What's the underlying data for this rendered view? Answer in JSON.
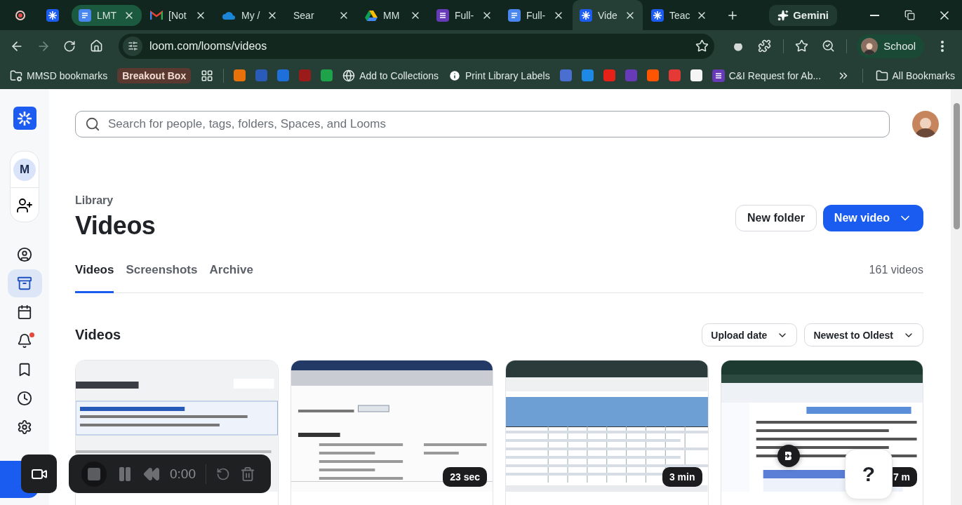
{
  "browser": {
    "tabs": [
      {
        "selected": false,
        "hovered": false
      },
      {
        "title": "LMT",
        "selected": false,
        "hovered": true
      },
      {
        "title": "[Not",
        "selected": false,
        "hovered": false
      },
      {
        "title": "My /",
        "selected": false,
        "hovered": false
      },
      {
        "title": "Sear",
        "selected": false,
        "hovered": false
      },
      {
        "title": "MM",
        "selected": false,
        "hovered": false
      },
      {
        "title": "Full-",
        "selected": false,
        "hovered": false
      },
      {
        "title": "Full-",
        "selected": false,
        "hovered": false
      },
      {
        "title": "Vide",
        "selected": true,
        "hovered": false
      },
      {
        "title": "Teac",
        "selected": false,
        "hovered": false
      }
    ],
    "gemini": "Gemini",
    "url": "loom.com/looms/videos",
    "profile": "School",
    "bookmarks": [
      {
        "kind": "folder",
        "label": "MMSD bookmarks"
      },
      {
        "kind": "chip",
        "label": "Breakout Box"
      },
      {
        "kind": "apps"
      },
      {
        "kind": "separator"
      },
      {
        "kind": "icon",
        "color": "#e8710a"
      },
      {
        "kind": "icon",
        "color": "#2a5bb8"
      },
      {
        "kind": "icon",
        "color": "#1e6fd9"
      },
      {
        "kind": "icon",
        "color": "#9b1b1b"
      },
      {
        "kind": "icon",
        "color": "#1fa34a"
      },
      {
        "kind": "link",
        "label": "Add to Collections"
      },
      {
        "kind": "link",
        "label": "Print Library Labels"
      },
      {
        "kind": "icon",
        "color": "#4a6fd1"
      },
      {
        "kind": "icon",
        "color": "#1e88e5"
      },
      {
        "kind": "icon",
        "color": "#e62117"
      },
      {
        "kind": "icon",
        "color": "#673ab7"
      },
      {
        "kind": "icon",
        "color": "#ff5500"
      },
      {
        "kind": "icon",
        "color": "#e53935"
      },
      {
        "kind": "icon",
        "color": "#f5f5f5"
      },
      {
        "kind": "link",
        "label": "C&I Request for Ab..."
      }
    ],
    "all_bookmarks": "All Bookmarks"
  },
  "sidebar": {
    "workspace_initial": "M",
    "nav": [
      {
        "selected": false,
        "unread": false
      },
      {
        "selected": true,
        "unread": false
      },
      {
        "selected": false,
        "unread": false
      },
      {
        "selected": false,
        "unread": true
      },
      {
        "selected": false,
        "unread": false
      },
      {
        "selected": false,
        "unread": false
      },
      {
        "selected": false,
        "unread": false
      }
    ]
  },
  "search": {
    "placeholder": "Search for people, tags, folders, Spaces, and Looms"
  },
  "header": {
    "eyebrow": "Library",
    "title": "Videos",
    "buttons": [
      {
        "kind": "secondary",
        "label": "New folder"
      },
      {
        "kind": "primary",
        "label": "New video"
      }
    ]
  },
  "tabs": [
    {
      "label": "Videos",
      "selected": true
    },
    {
      "label": "Screenshots",
      "selected": false
    },
    {
      "label": "Archive",
      "selected": false
    }
  ],
  "count": "161 videos",
  "section": {
    "title": "Videos",
    "filters": [
      "Upload date",
      "Newest to Oldest"
    ]
  },
  "videos": [
    {
      "kind": "picture"
    },
    {
      "kind": "picture",
      "duration": "23 sec"
    },
    {
      "kind": "picture",
      "duration": "3 min"
    },
    {
      "kind": "picture",
      "duration": "7 m"
    }
  ],
  "recorder": {
    "time": "0:00"
  },
  "help": "?"
}
